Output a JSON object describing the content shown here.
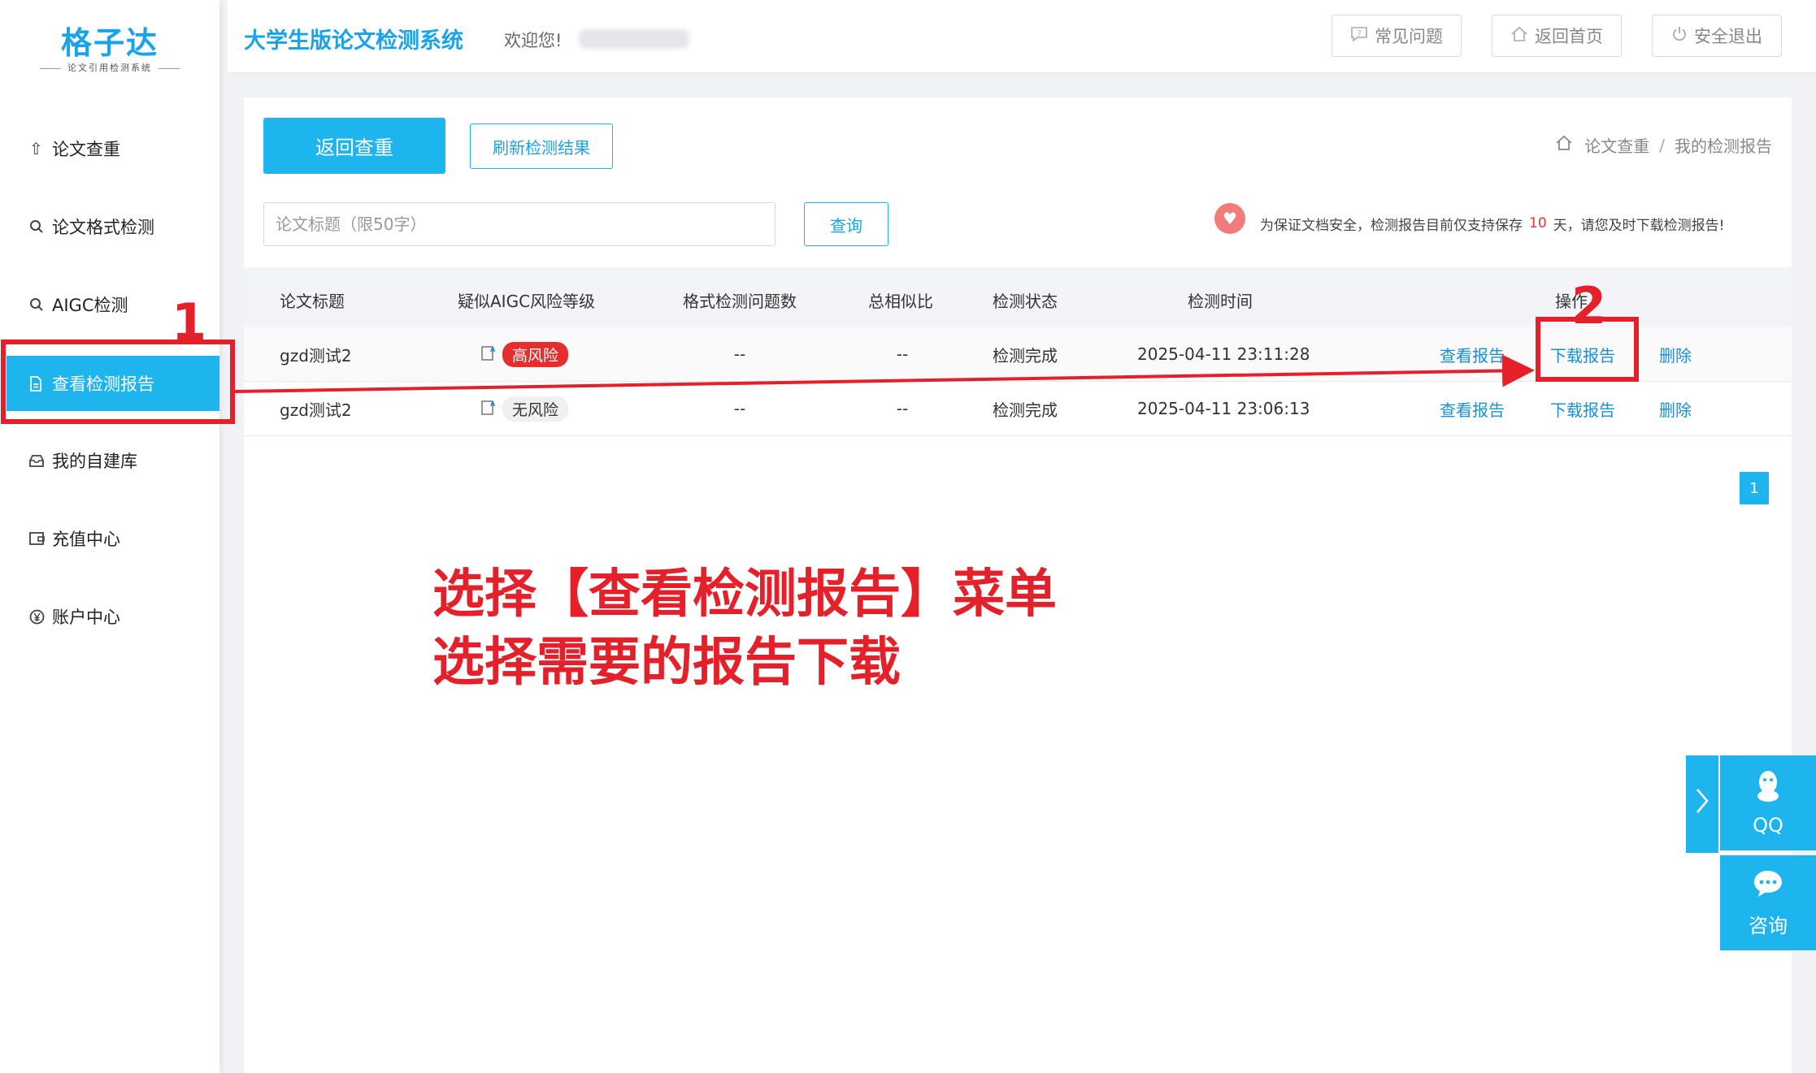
{
  "sidebar": {
    "logo": "格子达",
    "logo_sub": "论文引用检测系统",
    "items": [
      {
        "label": "论文查重",
        "icon": "upload-icon"
      },
      {
        "label": "论文格式检测",
        "icon": "search-icon"
      },
      {
        "label": "AIGC检测",
        "icon": "search-icon"
      },
      {
        "label": "查看检测报告",
        "icon": "document-icon",
        "active": true
      },
      {
        "label": "我的自建库",
        "icon": "inbox-icon"
      },
      {
        "label": "充值中心",
        "icon": "wallet-icon"
      },
      {
        "label": "账户中心",
        "icon": "yen-icon"
      }
    ]
  },
  "header": {
    "title": "大学生版论文检测系统",
    "welcome": "欢迎您!",
    "faq": "常见问题",
    "home": "返回首页",
    "logout": "安全退出"
  },
  "toolbar": {
    "back": "返回查重",
    "refresh": "刷新检测结果",
    "search_placeholder": "论文标题（限50字）",
    "search_btn": "查询"
  },
  "breadcrumb": {
    "first": "论文查重",
    "sep": "/",
    "second": "我的检测报告"
  },
  "notice": {
    "prefix": "为保证文档安全，检测报告目前仅支持保存",
    "days": "10",
    "suffix": "天，请您及时下载检测报告!"
  },
  "table": {
    "headers": [
      "论文标题",
      "疑似AIGC风险等级",
      "格式检测问题数",
      "总相似比",
      "检测状态",
      "检测时间",
      "操作"
    ],
    "rows": [
      {
        "title": "gzd测试2",
        "risk": "高风险",
        "format_issues": "--",
        "similarity": "--",
        "status": "检测完成",
        "time": "2025-04-11 23:11:28",
        "view": "查看报告",
        "download": "下载报告",
        "delete": "删除"
      },
      {
        "title": "gzd测试2",
        "risk": "无风险",
        "format_issues": "--",
        "similarity": "--",
        "status": "检测完成",
        "time": "2025-04-11 23:06:13",
        "view": "查看报告",
        "download": "下载报告",
        "delete": "删除"
      }
    ]
  },
  "pagination": {
    "current": "1"
  },
  "float": {
    "qq": "QQ",
    "consult": "咨询"
  },
  "annotations": {
    "num1": "1",
    "num2": "2",
    "line1": "选择【查看检测报告】菜单",
    "line2": "选择需要的报告下载",
    "color": "#e4202a"
  },
  "colors": {
    "accent": "#1eb5ef",
    "danger": "#e62e2e"
  }
}
